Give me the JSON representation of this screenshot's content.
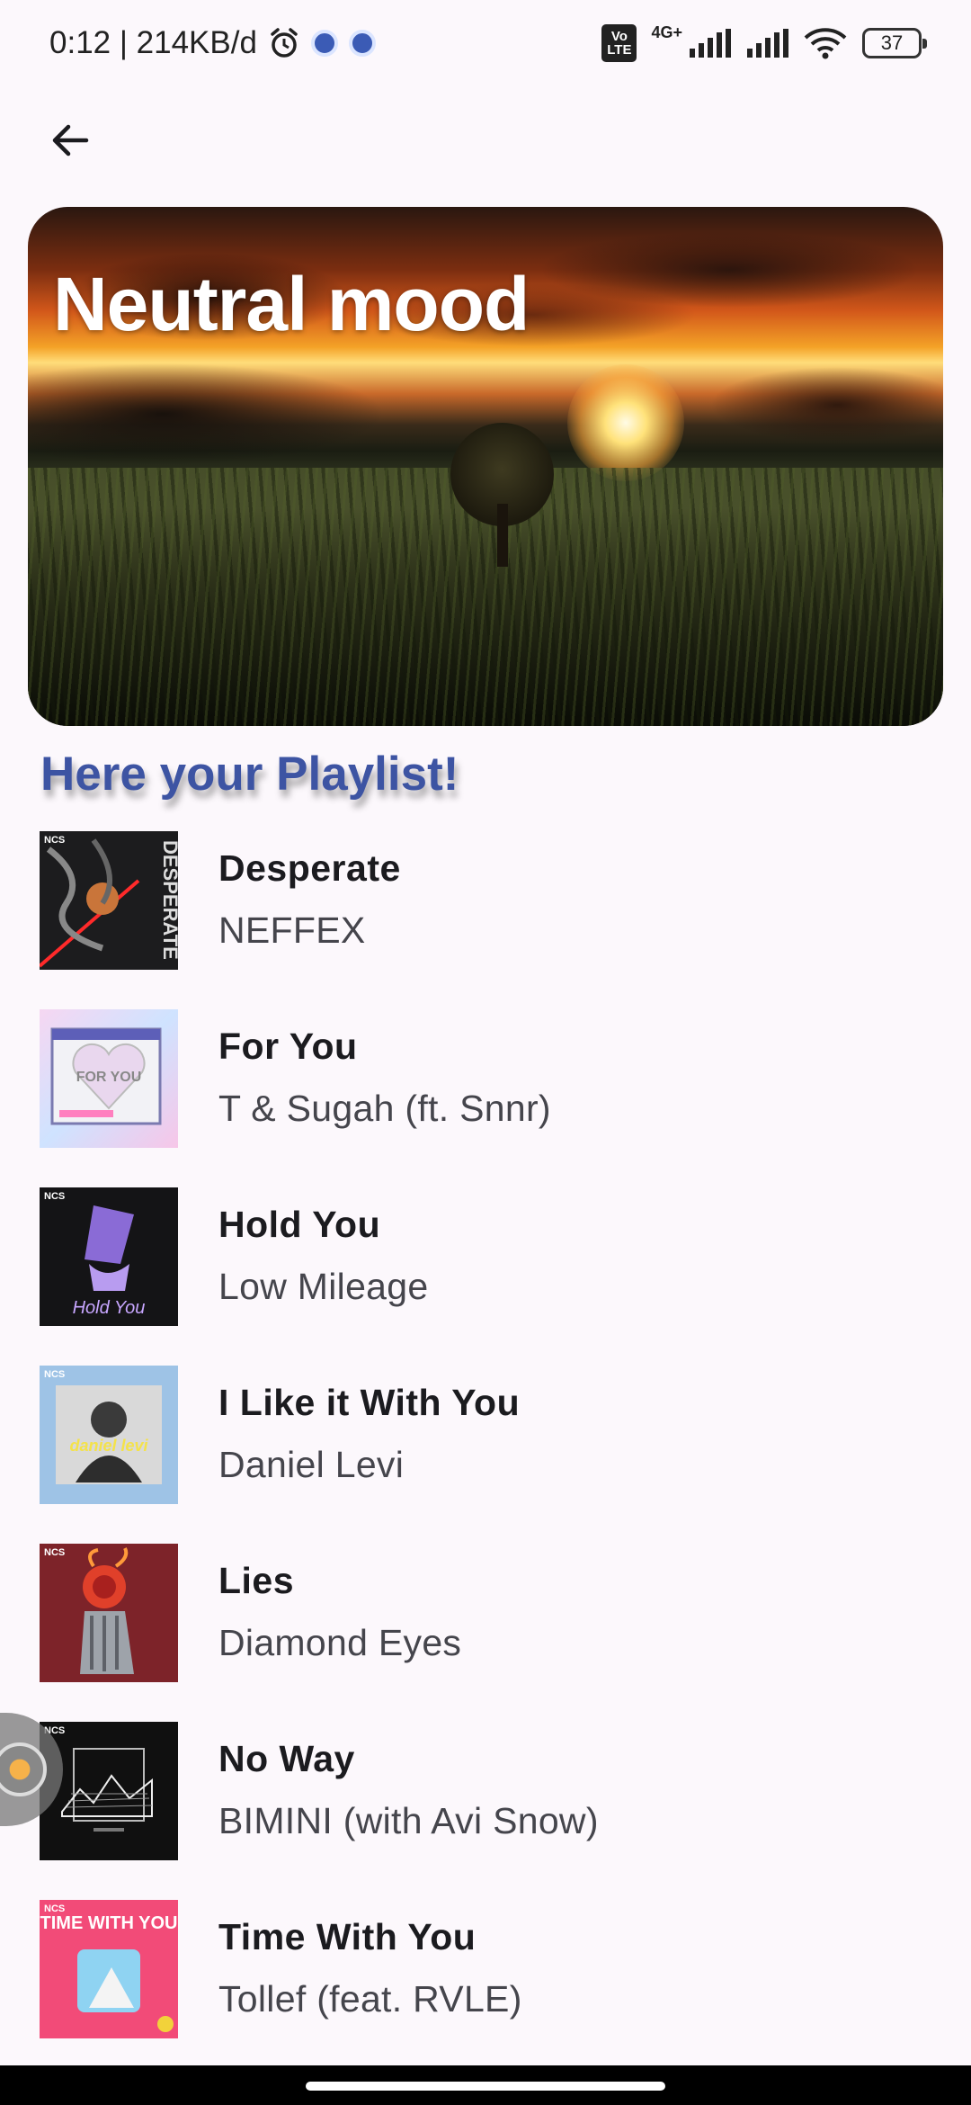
{
  "status_bar": {
    "time_and_speed": "0:12 | 214KB/d",
    "network": "4G+",
    "volte": "Vo LTE",
    "battery": "37"
  },
  "hero": {
    "title": "Neutral mood"
  },
  "playlist": {
    "heading": "Here your Playlist!",
    "tracks": [
      {
        "title": "Desperate",
        "artist": "NEFFEX"
      },
      {
        "title": "For You",
        "artist": "T & Sugah (ft. Snnr)"
      },
      {
        "title": "Hold You",
        "artist": "Low Mileage"
      },
      {
        "title": "I Like it With You",
        "artist": "Daniel Levi"
      },
      {
        "title": "Lies",
        "artist": "Diamond Eyes"
      },
      {
        "title": "No Way",
        "artist": "BIMINI (with Avi Snow)"
      },
      {
        "title": "Time With You",
        "artist": "Tollef (feat. RVLE)"
      }
    ]
  },
  "covers": {
    "ncs_label": "NCS",
    "cover1_text": "DESPERATE",
    "cover2_text": "FOR YOU",
    "cover3_text": "Hold You",
    "cover4_text": "daniel levi",
    "cover7_text": "TIME WITH YOU"
  },
  "icons": {
    "back": "arrow-left-icon",
    "alarm": "alarm-icon",
    "signal": "signal-icon",
    "wifi": "wifi-icon",
    "battery": "battery-icon"
  },
  "colors": {
    "background": "#fcf8fc",
    "heading": "#3d54a3",
    "title_text": "#1b1b1f",
    "artist_text": "#45454c"
  }
}
